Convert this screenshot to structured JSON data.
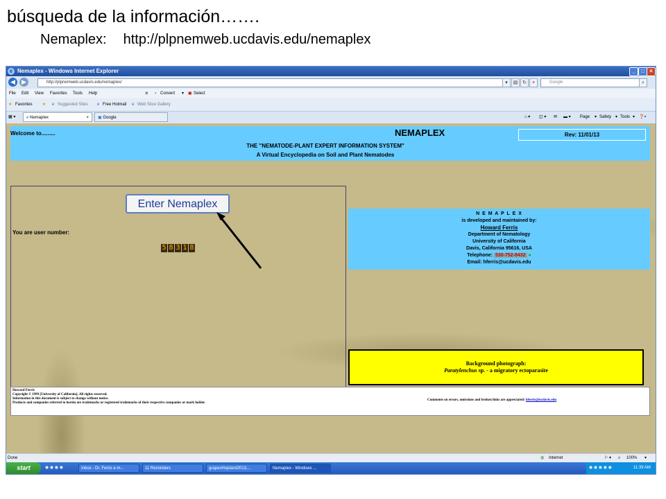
{
  "slide": {
    "title": "búsqueda de la información…….",
    "subtitle_label": "Nemaplex:",
    "subtitle_url": "http://plpnemweb.ucdavis.edu/nemaplex"
  },
  "browser": {
    "title": "Nemaplex - Windows Internet Explorer",
    "address": "http://plpnemweb.ucdavis.edu/nemaplex/",
    "search_placeholder": "Google",
    "menu": [
      "File",
      "Edit",
      "View",
      "Favorites",
      "Tools",
      "Help"
    ],
    "convert_label": "Convert",
    "select_label": "Select",
    "favorites": {
      "favorites_label": "Favorites",
      "suggested": "Suggested Sites",
      "hotmail": "Free Hotmail",
      "gallery": "Web Slice Gallery"
    },
    "tabs": [
      "Nemaplex",
      "Google"
    ],
    "commands": [
      "Page",
      "Safety",
      "Tools"
    ]
  },
  "page": {
    "welcome": "Welcome to.........",
    "site_title": "NEMAPLEX",
    "rev": "Rev: 11/01/13",
    "tagline1": "THE \"NEMATODE-PLANT EXPERT INFORMATION SYSTEM\"",
    "tagline2": "A Virtual Encyclopedia on Soil and Plant Nematodes",
    "enter_button": "Enter Nemaplex",
    "user_label": "You are user number:",
    "counter_digits": [
      "5",
      "8",
      "3",
      "1",
      "8"
    ],
    "info": {
      "name": "N E M A P L E X",
      "line2": "is developed and maintained by:",
      "person": "Howard Ferris",
      "dept": "Department of Nematology",
      "univ": "University of California",
      "city": "Davis, California 95616, USA",
      "phone_label": "Telephone:",
      "phone": "530-752-8432",
      "email": "Email: hferris@ucdavis.edu"
    },
    "bg_photo": {
      "title": "Background photograph:",
      "genus": "Paratylenchus",
      "desc": "sp.  - a migratory ectoparasite"
    },
    "footer": {
      "author": "Howard Ferris",
      "copyright": "Copyright © 1999 [University of California]. All rights reserved.",
      "notice": "Information in this document is subject to change without notice.",
      "trademarks": "Products and companies referred to herein are trademarks or registered trademarks of their respective companies or mark holder.",
      "comments": "Comments on errors, omissions and broken links are appreciated:",
      "comments_email": "hferris@ucdavis.edu"
    }
  },
  "status": {
    "left": "Done",
    "zone": "Internet",
    "zoom": "100%"
  },
  "taskbar": {
    "start": "start",
    "items": [
      "Inbox - Dr. Ferris e-m...",
      "11 Reminders",
      "grapesHopland2013....",
      "Nemaplex - Windows ..."
    ],
    "clock": "11:39 AM"
  },
  "colors": {
    "accent_blue": "#66ccff",
    "photo_bg": "#c6b98a",
    "highlight_yellow": "#ffff00"
  }
}
